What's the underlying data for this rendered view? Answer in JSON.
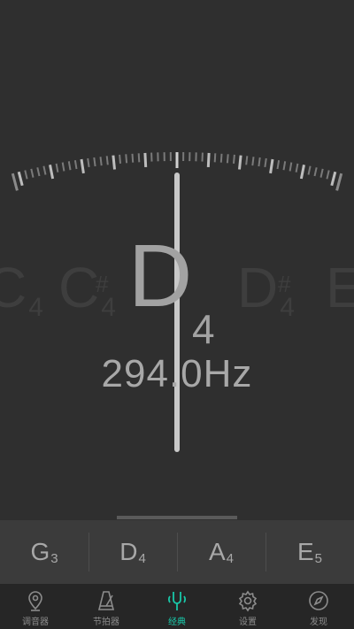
{
  "meter": {
    "note_letter": "D",
    "note_octave": "4",
    "frequency": "294.0Hz",
    "cents_offset": 0
  },
  "note_strip": [
    {
      "letter": "C",
      "octave": "4",
      "sharp": ""
    },
    {
      "letter": "C",
      "octave": "4",
      "sharp": "#"
    },
    {
      "letter": "D",
      "octave": "4",
      "sharp": "#"
    },
    {
      "letter": "E",
      "octave": "",
      "sharp": ""
    }
  ],
  "strings": [
    {
      "letter": "G",
      "octave": "3"
    },
    {
      "letter": "D",
      "octave": "4"
    },
    {
      "letter": "A",
      "octave": "4"
    },
    {
      "letter": "E",
      "octave": "5"
    }
  ],
  "tabs": [
    {
      "label": "调音器",
      "icon": "location-pin-icon",
      "active": false
    },
    {
      "label": "节拍器",
      "icon": "metronome-icon",
      "active": false
    },
    {
      "label": "经典",
      "icon": "tuning-fork-icon",
      "active": true
    },
    {
      "label": "设置",
      "icon": "gear-icon",
      "active": false
    },
    {
      "label": "发现",
      "icon": "compass-icon",
      "active": false
    }
  ],
  "colors": {
    "background": "#2f2f2f",
    "accent": "#19c7a8",
    "needle": "#c8c8c8"
  }
}
